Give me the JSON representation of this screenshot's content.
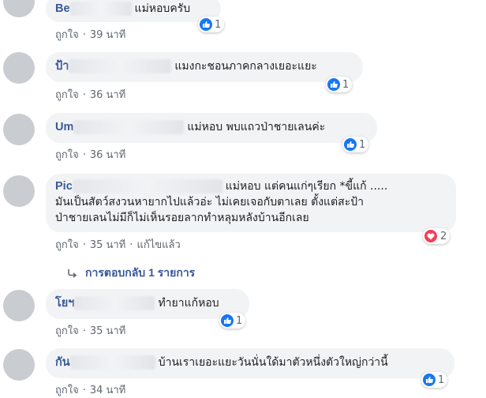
{
  "comments": [
    {
      "author_visible": "Be",
      "author_tail": "",
      "text": "แม่หอบครับ",
      "react": "1",
      "like_label": "ถูกใจ",
      "time": "39 นาที",
      "edited": ""
    },
    {
      "author_visible": "ป้า",
      "author_tail": "",
      "text": "แมงกะชอนภาคกลางเยอะแยะ",
      "react": "1",
      "like_label": "ถูกใจ",
      "time": "36 นาที",
      "edited": ""
    },
    {
      "author_visible": "Um",
      "author_tail": "",
      "text": "แม่หอบ พบแถวป่าชายเลนค่ะ",
      "react": "1",
      "like_label": "ถูกใจ",
      "time": "36 นาที",
      "edited": ""
    },
    {
      "author_visible": "Pic",
      "author_tail": "",
      "text": "แม่หอบ แต่คนแก่ๆเรียก *ขี้แก้ .....",
      "text_line2": "มันเป็นสัตว์สงวนหายากไปแล้วอ่ะ ไม่เคยเจอกับตาเลย ตั้งแต่สะป้า",
      "text_line3": "ป่าชายเลนไม่มีก็ไม่เห็นรอยลากทำหลุมหลังบ้านอีกเลย",
      "react": "2",
      "like_label": "ถูกใจ",
      "time": "35 นาที",
      "edited": "แก้ไขแล้ว"
    },
    {
      "author_visible": "โยฯ",
      "author_tail": "",
      "text": "ทำยาแก้หอบ",
      "react": "1",
      "like_label": "ถูกใจ",
      "time": "35 นาที",
      "edited": ""
    },
    {
      "author_visible": "กัน",
      "author_tail": "",
      "text": "บ้านเราเยอะแยะวันนั่นใด้มาตัวหนึ่งตัวใหญ่กว่านี้",
      "react": "1",
      "like_label": "ถูกใจ",
      "time": "34 นาที",
      "edited": ""
    }
  ],
  "replies_label": "การตอบกลับ 1 รายการ",
  "separator": "·",
  "colors": {
    "like": "#1877f2",
    "love": "#f33e58",
    "link": "#385898"
  },
  "icons": {
    "like": "thumbs-up-icon",
    "love": "heart-icon",
    "reply": "reply-arrow-icon"
  }
}
